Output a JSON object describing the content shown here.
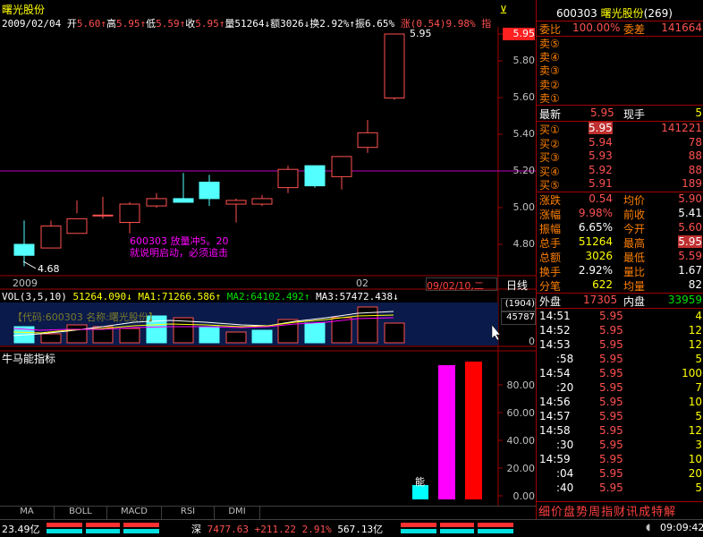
{
  "title": "曙光股份",
  "info_line": {
    "date": "2009/02/04",
    "open_label": "开",
    "open": "5.60",
    "high_label": "高",
    "high": "5.95",
    "low_label": "低",
    "low": "5.59",
    "close_label": "收",
    "close": "5.95",
    "volume_label": "量",
    "volume": "51264",
    "amount_label": "额",
    "amount": "3026",
    "turnover_label": "换",
    "turnover": "2.92%",
    "amplitude_label": "振",
    "amplitude": "6.65%",
    "change_label": "涨",
    "change": "(0.54)",
    "change_pct": "9.98%",
    "cut": "指"
  },
  "price_axis": [
    "5.95",
    "5.80",
    "5.60",
    "5.40",
    "5.20",
    "5.00",
    "4.80"
  ],
  "candle_labels": {
    "high": "5.95",
    "low": "4.68"
  },
  "annotation": {
    "line1": "600303 放量冲5。20",
    "line2": "就说明启动，必须追击"
  },
  "date_axis": {
    "left": "2009",
    "mid": "02",
    "cursor": "09/02/10,二",
    "period": "日线"
  },
  "vol_line": {
    "label": "VOL(3,5,10)",
    "value": "51264.090",
    "ma1_label": "MA1:",
    "ma1": "71266.586",
    "ma2_label": "MA2:",
    "ma2": "64102.492",
    "ma3_label": "MA3:",
    "ma3": "57472.438"
  },
  "vol_ghost": "【代码:600303 名称:曙光股份】",
  "vol_axis": {
    "scale": "(1904)",
    "value": "45787",
    "zero": "0"
  },
  "indicator": {
    "title": "牛马能指标",
    "label": "能",
    "axis": [
      "80.00",
      "60.00",
      "40.00",
      "20.00",
      "0.00"
    ]
  },
  "bottom_tabs": [
    "MA",
    "BOLL",
    "MACD",
    "RSI",
    "DMI"
  ],
  "right_panel": {
    "code": "600303",
    "name": "曙光股份",
    "rank": "(269)",
    "ratio_label": "委比",
    "ratio": "100.00%",
    "diff_label": "委差",
    "diff": "141664",
    "sells": [
      "卖⑤",
      "卖④",
      "卖③",
      "卖②",
      "卖①"
    ],
    "latest_label": "最新",
    "latest": "5.95",
    "now_label": "现手",
    "now": "5",
    "buys": [
      {
        "label": "买①",
        "price": "5.95",
        "vol": "141221"
      },
      {
        "label": "买②",
        "price": "5.94",
        "vol": "78"
      },
      {
        "label": "买③",
        "price": "5.93",
        "vol": "88"
      },
      {
        "label": "买④",
        "price": "5.92",
        "vol": "88"
      },
      {
        "label": "买⑤",
        "price": "5.91",
        "vol": "189"
      }
    ],
    "stats": [
      {
        "l1": "涨跌",
        "v1": "0.54",
        "l2": "均价",
        "v2": "5.90"
      },
      {
        "l1": "涨幅",
        "v1": "9.98%",
        "l2": "前收",
        "v2": "5.41"
      },
      {
        "l1": "振幅",
        "v1": "6.65%",
        "l2": "今开",
        "v2": "5.60"
      },
      {
        "l1": "总手",
        "v1": "51264",
        "l2": "最高",
        "v2": "5.95"
      },
      {
        "l1": "总额",
        "v1": "3026",
        "l2": "最低",
        "v2": "5.59"
      },
      {
        "l1": "换手",
        "v1": "2.92%",
        "l2": "量比",
        "v2": "1.67"
      },
      {
        "l1": "分笔",
        "v1": "622",
        "l2": "均量",
        "v2": "82"
      }
    ],
    "outer_label": "外盘",
    "outer": "17305",
    "inner_label": "内盘",
    "inner": "33959",
    "ticks": [
      {
        "t": "14:51",
        "p": "5.95",
        "v": "4"
      },
      {
        "t": "14:52",
        "p": "5.95",
        "v": "12"
      },
      {
        "t": "14:53",
        "p": "5.95",
        "v": "12"
      },
      {
        "t": ":58",
        "p": "5.95",
        "v": "5"
      },
      {
        "t": "14:54",
        "p": "5.95",
        "v": "100"
      },
      {
        "t": ":20",
        "p": "5.95",
        "v": "7"
      },
      {
        "t": "14:56",
        "p": "5.95",
        "v": "10"
      },
      {
        "t": "14:57",
        "p": "5.95",
        "v": "5"
      },
      {
        "t": "14:58",
        "p": "5.95",
        "v": "12"
      },
      {
        "t": ":30",
        "p": "5.95",
        "v": "3"
      },
      {
        "t": "14:59",
        "p": "5.95",
        "v": "10"
      },
      {
        "t": ":04",
        "p": "5.95",
        "v": "20"
      },
      {
        "t": ":40",
        "p": "5.95",
        "v": "5"
      }
    ],
    "tabs": [
      "细",
      "价",
      "盘",
      "势",
      "周",
      "指",
      "财",
      "讯",
      "成",
      "特",
      "解"
    ]
  },
  "status": {
    "left": "23.49亿",
    "index_label": "深",
    "index": "7477.63",
    "index_chg": "+211.22",
    "index_pct": "2.91%",
    "index_amt": "567.13亿",
    "time": "09:09:42"
  },
  "colors": {
    "up": "#ff5050",
    "down": "#54ffff",
    "magenta": "#ff00ff",
    "axis": "#a00000"
  }
}
